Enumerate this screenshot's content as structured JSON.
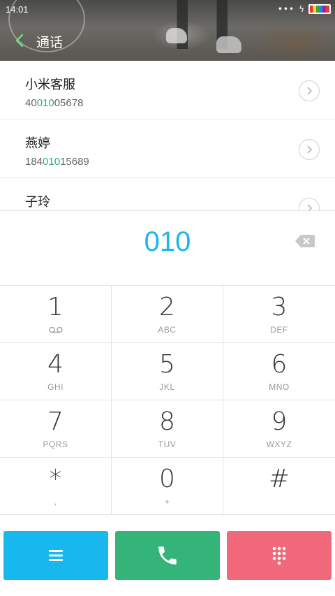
{
  "status_bar": {
    "time": "14:01",
    "dots": "•••",
    "bolt": "ϟ"
  },
  "header": {
    "title": "通话"
  },
  "contacts": [
    {
      "name": "小米客服",
      "number_pre": "40",
      "number_match": "010",
      "number_post": "05678"
    },
    {
      "name": "燕婷",
      "number_pre": "184",
      "number_match": "010",
      "number_post": "15689"
    },
    {
      "name": "子玲",
      "number_pre": "",
      "number_match": "",
      "number_post": ""
    }
  ],
  "dial": {
    "digits": "010"
  },
  "keypad": [
    {
      "digit": "1",
      "letters": ""
    },
    {
      "digit": "2",
      "letters": "ABC"
    },
    {
      "digit": "3",
      "letters": "DEF"
    },
    {
      "digit": "4",
      "letters": "GHI"
    },
    {
      "digit": "5",
      "letters": "JKL"
    },
    {
      "digit": "6",
      "letters": "MNO"
    },
    {
      "digit": "7",
      "letters": "PQRS"
    },
    {
      "digit": "8",
      "letters": "TUV"
    },
    {
      "digit": "9",
      "letters": "WXYZ"
    },
    {
      "digit": "*",
      "letters": ","
    },
    {
      "digit": "0",
      "letters": "+"
    },
    {
      "digit": "#",
      "letters": ""
    }
  ],
  "actions": {
    "menu_icon": "menu-icon",
    "call_icon": "phone-icon",
    "keypad_icon": "dialpad-icon"
  },
  "colors": {
    "accent_blue": "#1bb6ef",
    "match_green": "#2dae6e",
    "call_green": "#35b47a",
    "pad_pink": "#f1687a",
    "menu_blue": "#18b7ee"
  }
}
